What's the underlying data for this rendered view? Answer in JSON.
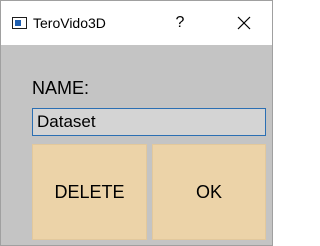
{
  "window": {
    "title": "TeroVido3D",
    "help_label": "?",
    "close_icon": "close-icon",
    "app_icon": "window-app-icon"
  },
  "form": {
    "name_label": "NAME:",
    "name_value": "Dataset"
  },
  "buttons": {
    "delete_label": "DELETE",
    "ok_label": "OK"
  },
  "colors": {
    "background": "#c4c4c4",
    "button_bg": "#ecd3a8",
    "input_border": "#2b6fb3",
    "titlebar_bg": "#ffffff"
  }
}
